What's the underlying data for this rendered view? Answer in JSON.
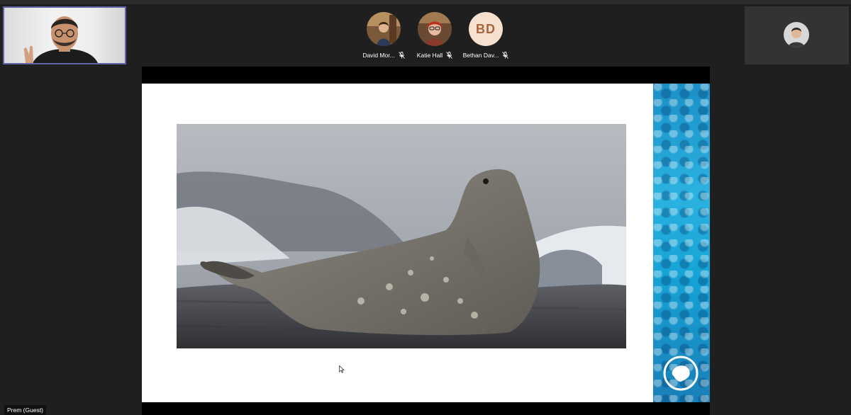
{
  "meeting": {
    "self_view": {
      "name_tag": "Prem (Guest)"
    },
    "participants": [
      {
        "name": "David Mor...",
        "avatar": "photo",
        "muted": true,
        "mic_icon": "mic-off-icon"
      },
      {
        "name": "Katie Hall",
        "avatar": "photo",
        "muted": true,
        "mic_icon": "mic-off-icon"
      },
      {
        "name": "Bethan Dav...",
        "avatar": "initials",
        "initials": "BD",
        "muted": true,
        "mic_icon": "mic-off-icon"
      }
    ],
    "shared_content": {
      "type": "presentation-slide",
      "image_subject": "seal"
    },
    "colors": {
      "background": "#1f1f1f",
      "self_tile_border": "#6264a7",
      "initials_bg": "#f6e0cf",
      "initials_fg": "#a8643a",
      "slide_accent": "#1fa3d8"
    }
  }
}
